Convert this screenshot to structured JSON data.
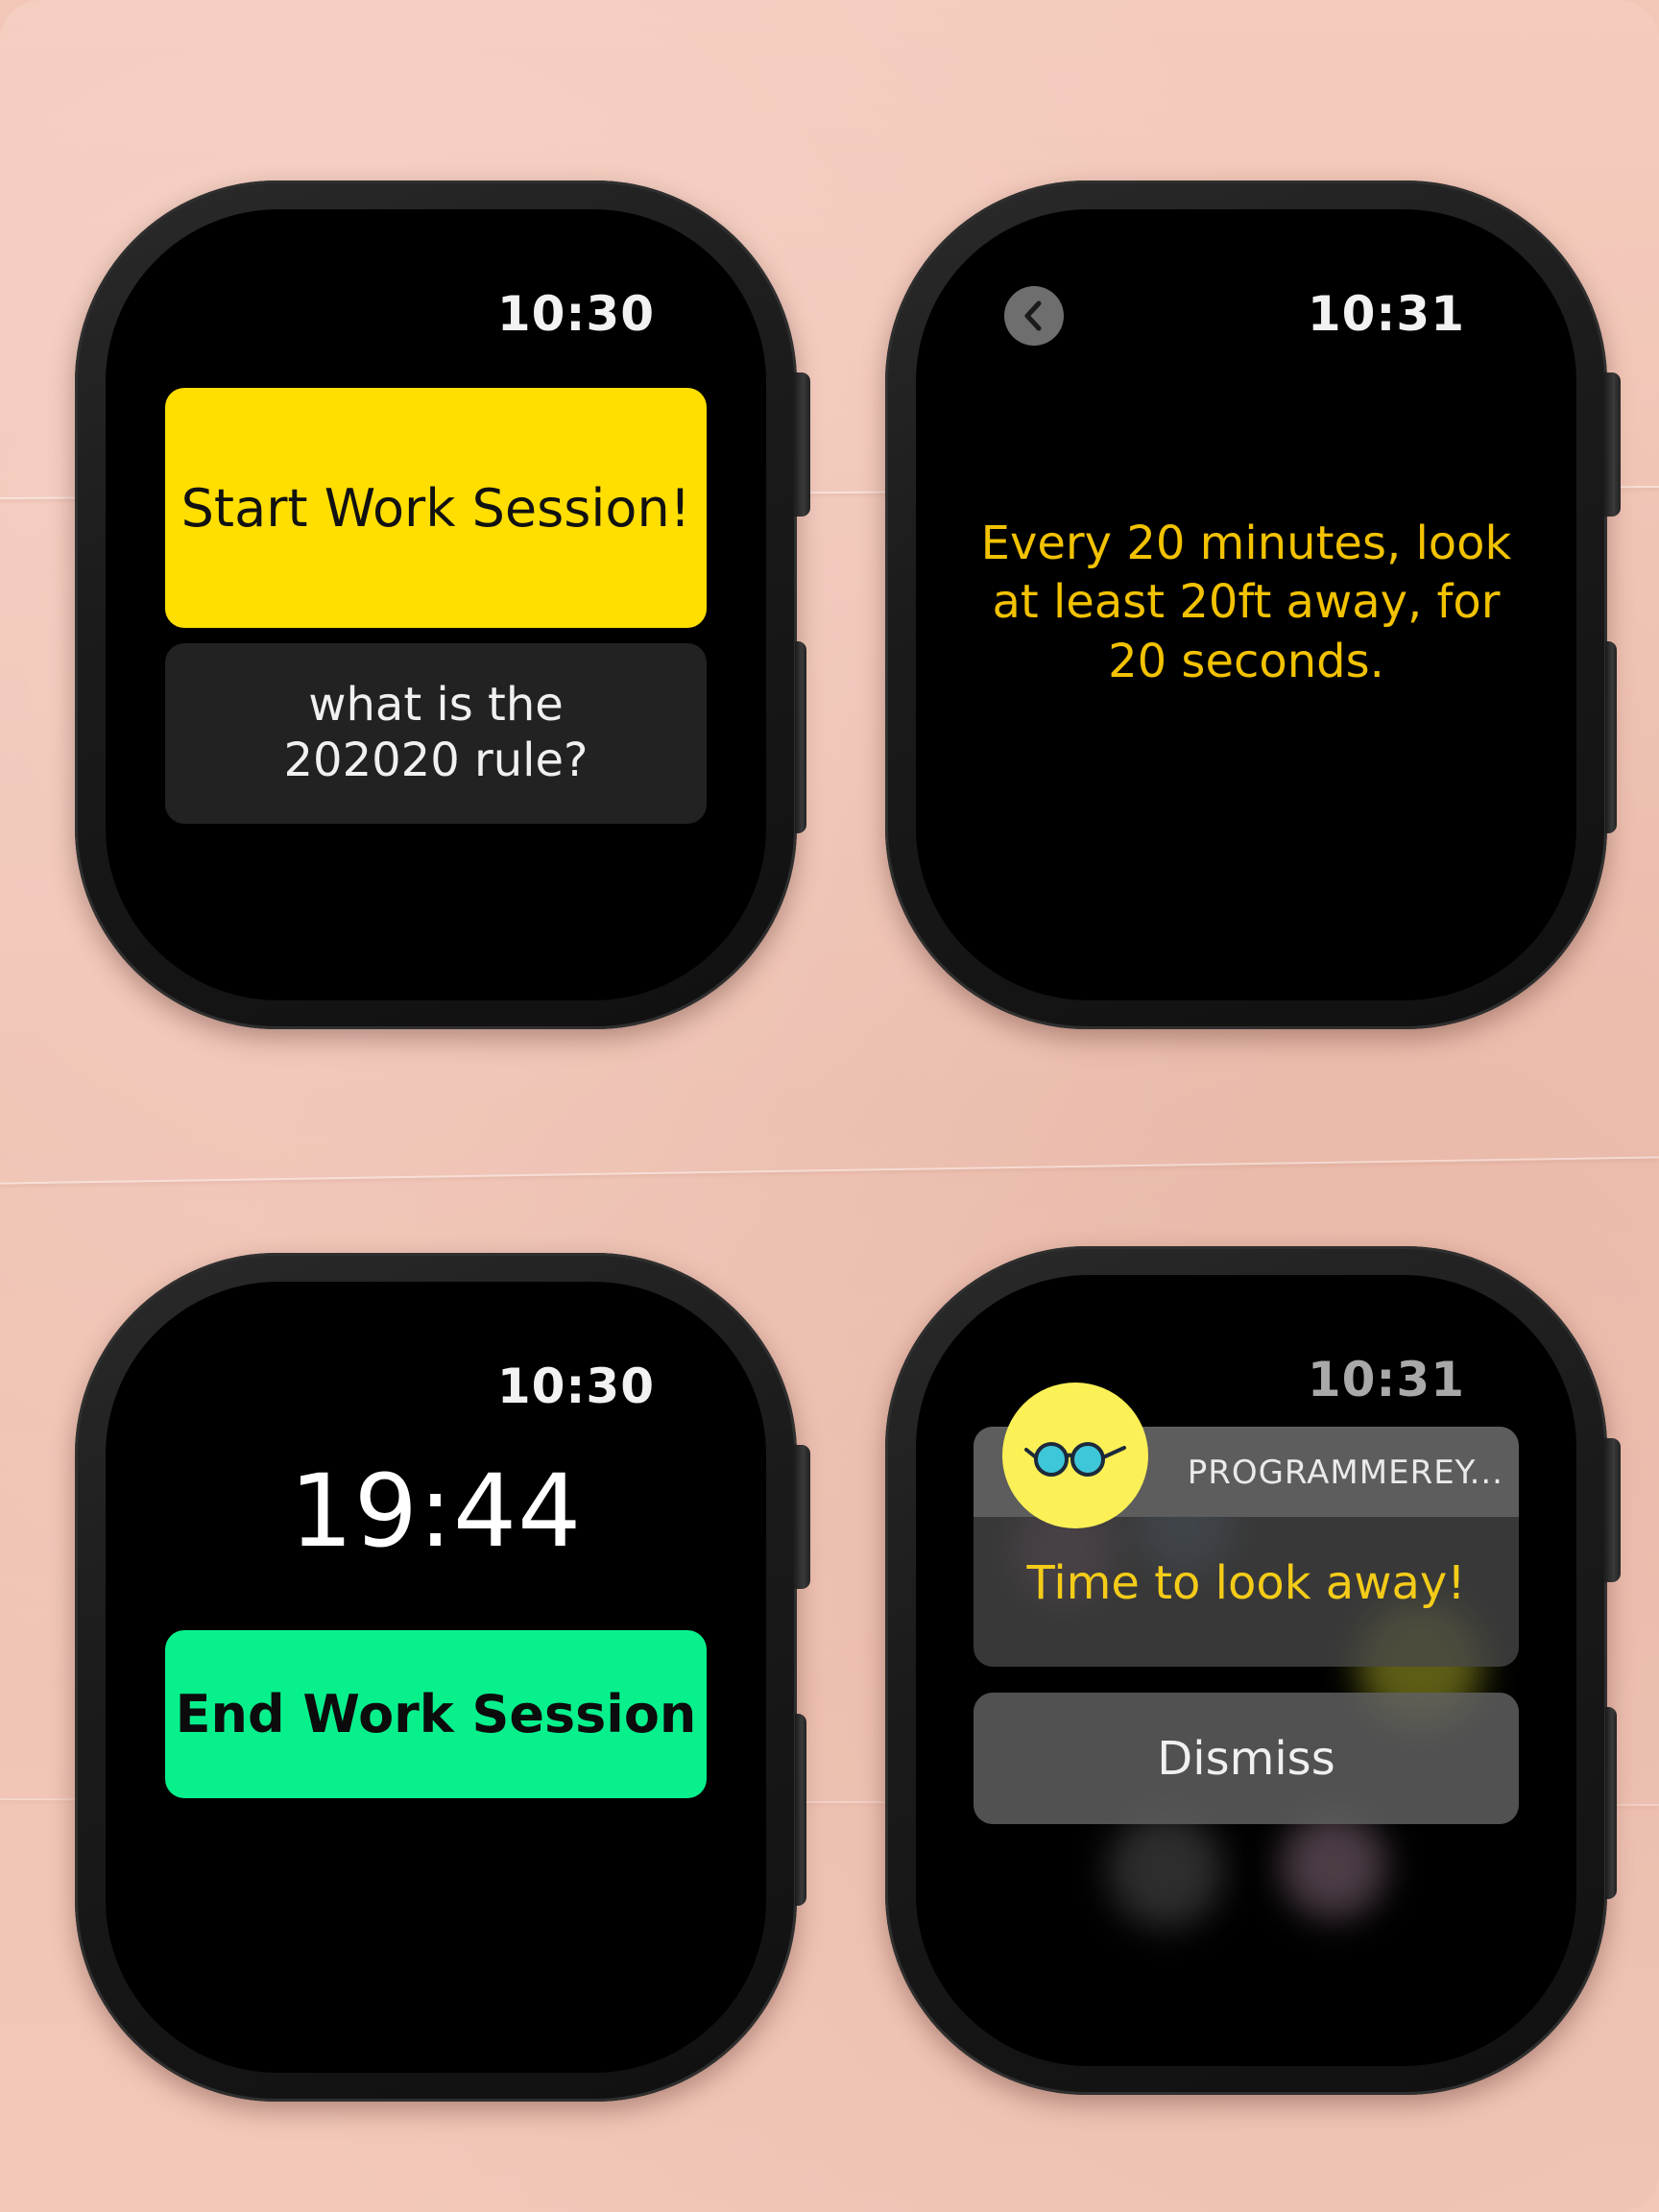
{
  "watch1": {
    "time": "10:30",
    "start_button": "Start Work Session!",
    "rule_button": "what is the 202020 rule?"
  },
  "watch2": {
    "time": "10:31",
    "back_icon": "chevron-left-icon",
    "rule_text": "Every 20 minutes, look at least 20ft away, for 20 seconds."
  },
  "watch3": {
    "time": "10:30",
    "countdown": "19:44",
    "end_button": "End Work Session"
  },
  "watch4": {
    "time": "10:31",
    "app_icon": "glasses-icon",
    "app_name": "PROGRAMMEREY...",
    "message": "Time to look away!",
    "dismiss_button": "Dismiss"
  },
  "colors": {
    "background": "#f2c7b8",
    "start_button": "#ffde00",
    "end_button": "#08f08c",
    "rule_text": "#f2c200",
    "app_icon": "#fbf056"
  }
}
